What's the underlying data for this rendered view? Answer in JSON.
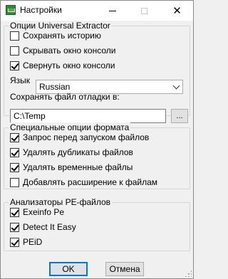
{
  "window": {
    "title": "Настройки",
    "icon": "ue-icon"
  },
  "general": {
    "title": "Опции Universal Extractor",
    "options": [
      {
        "label": "Сохранять историю",
        "checked": false
      },
      {
        "label": "Скрывать окно консоли",
        "checked": false
      },
      {
        "label": "Свернуть окно консоли",
        "checked": true
      }
    ],
    "language_label": "Язык",
    "language_value": "Russian",
    "debug_label": "Сохранять файл отладки в:",
    "debug_path": "C:\\Temp",
    "browse_label": "..."
  },
  "format": {
    "title": "Специальные опции формата",
    "options": [
      {
        "label": "Запрос перед запуском файлов",
        "checked": true
      },
      {
        "label": "Удалять дубликаты файлов",
        "checked": true
      },
      {
        "label": "Удалять временные файлы",
        "checked": true
      },
      {
        "label": "Добавлять расширение к файлам",
        "checked": false
      }
    ]
  },
  "analyzers": {
    "title": "Анализаторы PE-файлов",
    "options": [
      {
        "label": "Exeinfo Pe",
        "checked": true
      },
      {
        "label": "Detect It Easy",
        "checked": true
      },
      {
        "label": "PEiD",
        "checked": true
      }
    ]
  },
  "buttons": {
    "ok": "OK",
    "cancel": "Отмена"
  }
}
